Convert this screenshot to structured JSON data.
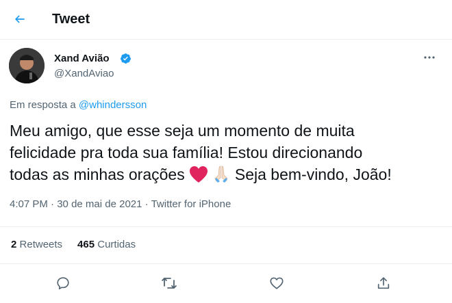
{
  "header": {
    "title": "Tweet",
    "back_icon": "arrow-left-icon",
    "accent": "#1d9bf0"
  },
  "author": {
    "name": "Xand Avião",
    "handle": "@XandAviao",
    "verified": true,
    "verified_icon": "verified-badge-icon"
  },
  "reply": {
    "prefix": "Em resposta a",
    "mention": "@whindersson"
  },
  "tweet": {
    "line1": "Meu amigo, que esse seja um momento de muita",
    "line2": "felicidade pra toda sua família! Estou direcionando",
    "line3_before": "todas as minhas orações",
    "line3_after": "Seja bem-vindo, João!",
    "emojis": [
      "red-heart-emoji",
      "folded-hands-emoji"
    ]
  },
  "meta": {
    "time": "4:07 PM",
    "separator": "·",
    "date": "30 de mai de 2021",
    "source": "Twitter for iPhone"
  },
  "stats": {
    "retweets_count": "2",
    "retweets_label": "Retweets",
    "likes_count": "465",
    "likes_label": "Curtidas"
  },
  "actions": [
    "reply-icon",
    "retweet-icon",
    "like-icon",
    "share-icon"
  ],
  "colors": {
    "text": "#0f1419",
    "secondary": "#536471",
    "link": "#1d9bf0",
    "divider": "#ebeef0",
    "heart": "#e0245e"
  }
}
